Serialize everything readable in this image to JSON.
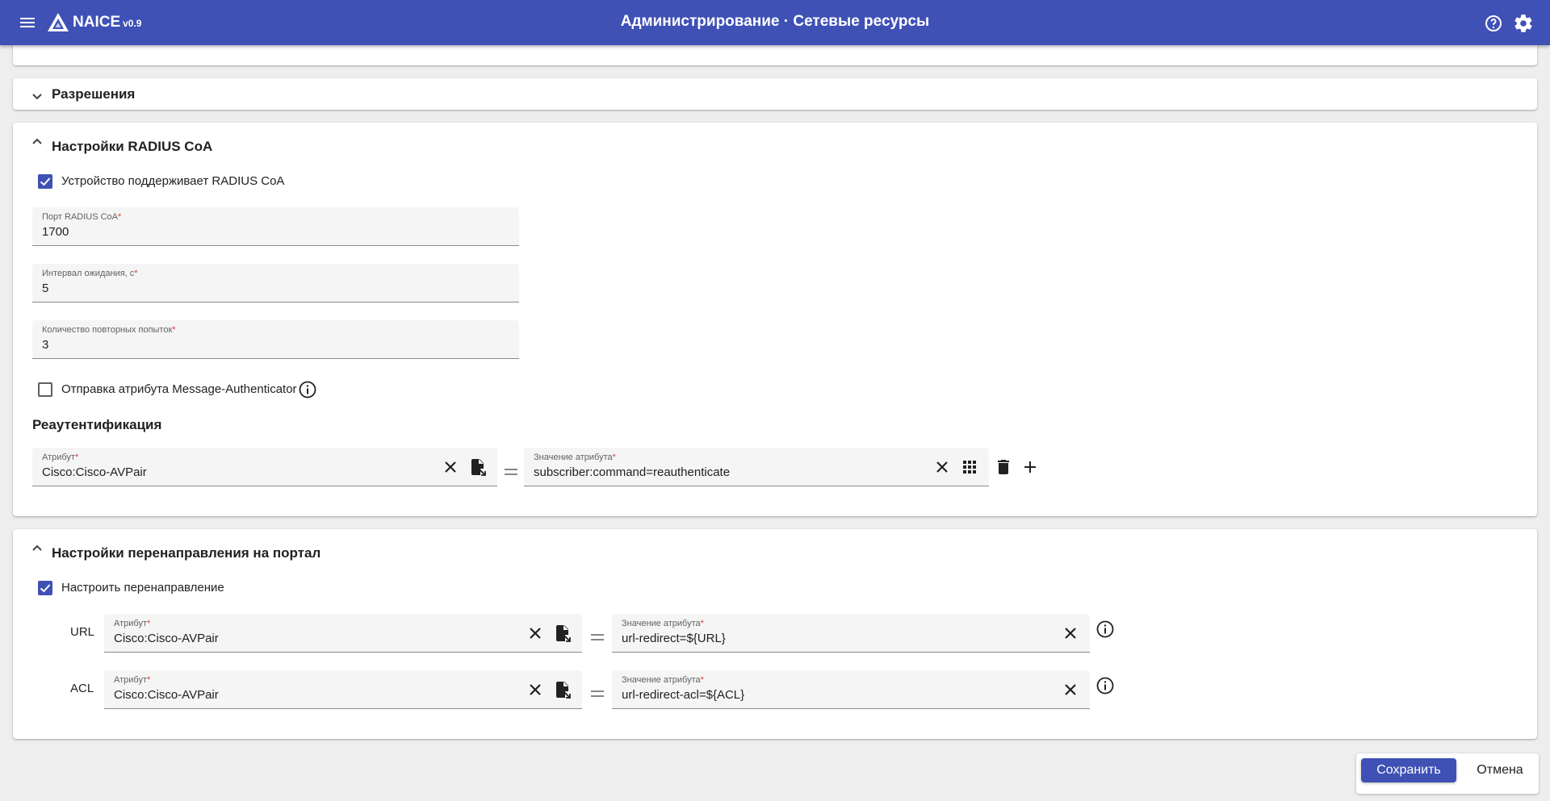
{
  "app": {
    "brand": "NAICE",
    "version": "v0.9",
    "title": "Администрирование · Сетевые ресурсы",
    "accent_color": "#3f51b5",
    "icons": [
      "menu-icon",
      "logo-icon",
      "help-icon",
      "settings-icon"
    ]
  },
  "permissions_panel": {
    "title": "Разрешения",
    "expanded": false
  },
  "coa_panel": {
    "title": "Настройки RADIUS CoA",
    "expanded": true,
    "supports_coa": {
      "label": "Устройство поддерживает RADIUS CoA",
      "checked": true
    },
    "port": {
      "label": "Порт RADIUS CoA",
      "required_mark": "*",
      "value": "1700"
    },
    "timeout": {
      "label": "Интервал ожидания, с",
      "required_mark": "*",
      "value": "5"
    },
    "retries": {
      "label": "Количество повторных попыток",
      "required_mark": "*",
      "value": "3"
    },
    "message_authenticator": {
      "label": "Отправка атрибута Message-Authenticator",
      "checked": false
    },
    "reauth": {
      "title": "Реаутентификация",
      "attribute": {
        "label": "Атрибут",
        "required_mark": "*",
        "value": "Cisco:Cisco-AVPair"
      },
      "value": {
        "label": "Значение атрибута",
        "required_mark": "*",
        "value": "subscriber:command=reauthenticate"
      }
    }
  },
  "redirect_panel": {
    "title": "Настройки перенаправления на портал",
    "expanded": true,
    "configure_redirect": {
      "label": "Настроить перенаправление",
      "checked": true
    },
    "rows": [
      {
        "label": "URL",
        "attribute": {
          "label": "Атрибут",
          "required_mark": "*",
          "value": "Cisco:Cisco-AVPair"
        },
        "value": {
          "label": "Значение атрибута",
          "required_mark": "*",
          "value": "url-redirect=${URL}"
        }
      },
      {
        "label": "ACL",
        "attribute": {
          "label": "Атрибут",
          "required_mark": "*",
          "value": "Cisco:Cisco-AVPair"
        },
        "value": {
          "label": "Значение атрибута",
          "required_mark": "*",
          "value": "url-redirect-acl=${ACL}"
        }
      }
    ]
  },
  "footer": {
    "save_label": "Сохранить",
    "cancel_label": "Отмена"
  }
}
